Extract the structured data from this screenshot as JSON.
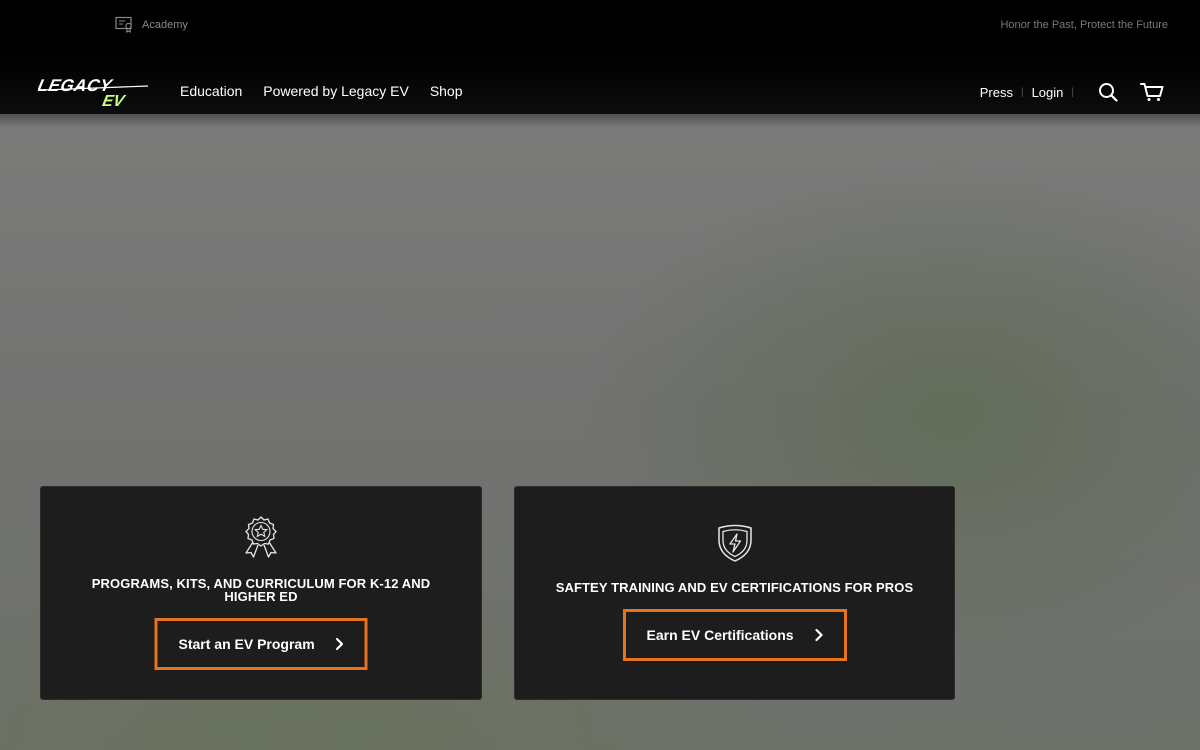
{
  "topbar": {
    "academy_label": "Academy",
    "tagline": "Honor the Past, Protect the Future"
  },
  "brand": {
    "logo_line1": "LEGACY",
    "logo_line2": "EV"
  },
  "nav": {
    "links": [
      {
        "label": "Education"
      },
      {
        "label": "Powered by Legacy EV"
      },
      {
        "label": "Shop"
      }
    ],
    "right": {
      "press": "Press",
      "login": "Login",
      "separator": "|"
    }
  },
  "cards": [
    {
      "icon": "award-ribbon-icon",
      "title": "PROGRAMS, KITS, AND CURRICULUM FOR K-12 AND HIGHER ED",
      "cta": "Start an EV Program"
    },
    {
      "icon": "shield-lightning-icon",
      "title": "SAFTEY TRAINING AND EV CERTIFICATIONS FOR PROS",
      "cta": "Earn EV Certifications"
    }
  ],
  "colors": {
    "accent": "#e8731d",
    "card_bg": "#1d1d1d",
    "header_bg": "#000000"
  }
}
